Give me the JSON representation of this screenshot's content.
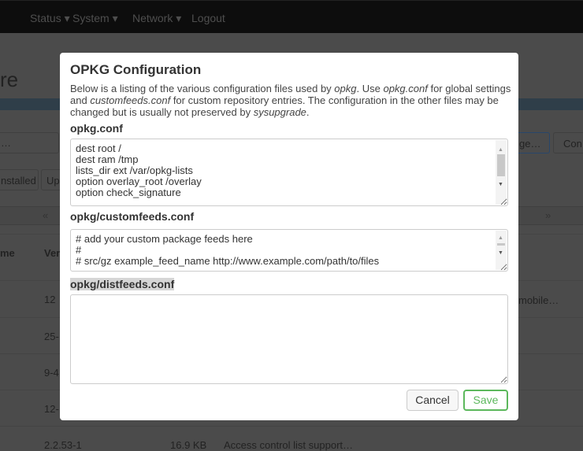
{
  "nav": {
    "items": [
      "Status ▾",
      "System ▾",
      "Network ▾",
      "Logout"
    ]
  },
  "background": {
    "page_title_fragment": "re",
    "filter_fragment": "…",
    "tabs": [
      "nstalled",
      "Up"
    ],
    "buttons": [
      "ge…",
      "Con"
    ],
    "pager": {
      "prev": "«",
      "next": "»"
    },
    "columns": [
      "me",
      "Ver"
    ],
    "versions": [
      "12",
      "25-",
      "9-4",
      "12-"
    ],
    "desc_fragment": "mobile…",
    "last_row": {
      "version": "2.2.53-1",
      "size": "16.9 KB",
      "description": "Access control list support…"
    }
  },
  "modal": {
    "title": "OPKG Configuration",
    "desc": {
      "p1": "Below is a listing of the various configuration files used by ",
      "e1": "opkg",
      "p2": ". Use ",
      "e2": "opkg.conf",
      "p3": " for global settings and ",
      "e3": "customfeeds.conf",
      "p4": " for custom repository entries. The configuration in the other files may be changed but is usually not preserved by ",
      "e4": "sysupgrade",
      "p5": "."
    },
    "files": [
      {
        "name": "opkg.conf",
        "content": "dest root /\ndest ram /tmp\nlists_dir ext /var/opkg-lists\noption overlay_root /overlay\noption check_signature"
      },
      {
        "name": "opkg/customfeeds.conf",
        "content": "# add your custom package feeds here\n#\n# src/gz example_feed_name http://www.example.com/path/to/files"
      },
      {
        "name": "opkg/distfeeds.conf",
        "content": ""
      }
    ],
    "cancel": "Cancel",
    "save": "Save"
  },
  "colors": {
    "save": "#5cb85c",
    "overlay": "#4b4b4b",
    "navbar": "#0d0d0d"
  }
}
